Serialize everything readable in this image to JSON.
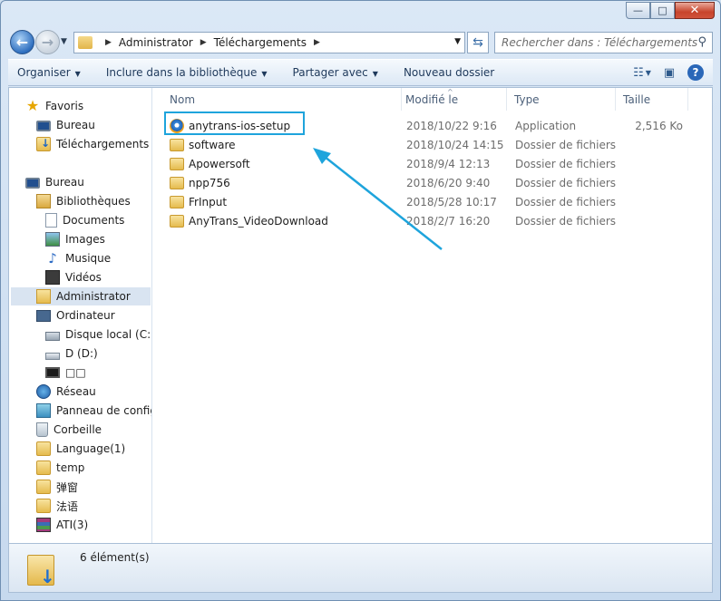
{
  "window": {
    "minimize_glyph": "—",
    "maximize_glyph": "□",
    "close_glyph": "✕"
  },
  "address": {
    "crumbs": [
      "Administrator",
      "Téléchargements"
    ],
    "search_placeholder": "Rechercher dans : Téléchargements"
  },
  "toolbar": {
    "organize": "Organiser",
    "include": "Inclure dans la bibliothèque",
    "share": "Partager avec",
    "new_folder": "Nouveau dossier"
  },
  "sidebar": {
    "items": [
      {
        "label": "Favoris",
        "icon": "star-icon"
      },
      {
        "label": "Bureau",
        "icon": "desktop-icon"
      },
      {
        "label": "Téléchargements",
        "icon": "downloads-folder-icon"
      },
      {
        "label": "Bureau",
        "icon": "desktop-icon"
      },
      {
        "label": "Bibliothèques",
        "icon": "libraries-icon"
      },
      {
        "label": "Documents",
        "icon": "document-icon"
      },
      {
        "label": "Images",
        "icon": "image-icon"
      },
      {
        "label": "Musique",
        "icon": "music-icon"
      },
      {
        "label": "Vidéos",
        "icon": "video-icon"
      },
      {
        "label": "Administrator",
        "icon": "user-folder-icon"
      },
      {
        "label": "Ordinateur",
        "icon": "computer-icon"
      },
      {
        "label": "Disque local (C:)",
        "icon": "local-disk-icon"
      },
      {
        "label": "D (D:)",
        "icon": "drive-icon"
      },
      {
        "label": "□□",
        "icon": "media-drive-icon"
      },
      {
        "label": "Réseau",
        "icon": "network-icon"
      },
      {
        "label": "Panneau de configu",
        "icon": "control-panel-icon"
      },
      {
        "label": "Corbeille",
        "icon": "recycle-bin-icon"
      },
      {
        "label": "Language(1)",
        "icon": "folder-icon"
      },
      {
        "label": "temp",
        "icon": "folder-icon"
      },
      {
        "label": "弹窗",
        "icon": "folder-icon"
      },
      {
        "label": "法语",
        "icon": "folder-icon"
      },
      {
        "label": "ATI(3)",
        "icon": "archive-icon"
      }
    ]
  },
  "columns": {
    "name": "Nom",
    "modified": "Modifié le",
    "type": "Type",
    "size": "Taille"
  },
  "files": [
    {
      "name": "anytrans-ios-setup",
      "modified": "2018/10/22 9:16",
      "type": "Application",
      "size": "2,516 Ko",
      "icon": "application-icon"
    },
    {
      "name": "software",
      "modified": "2018/10/24 14:15",
      "type": "Dossier de fichiers",
      "size": "",
      "icon": "folder-icon"
    },
    {
      "name": "Apowersoft",
      "modified": "2018/9/4 12:13",
      "type": "Dossier de fichiers",
      "size": "",
      "icon": "folder-icon"
    },
    {
      "name": "npp756",
      "modified": "2018/6/20 9:40",
      "type": "Dossier de fichiers",
      "size": "",
      "icon": "folder-icon"
    },
    {
      "name": "FrInput",
      "modified": "2018/5/28 10:17",
      "type": "Dossier de fichiers",
      "size": "",
      "icon": "folder-icon"
    },
    {
      "name": "AnyTrans_VideoDownload",
      "modified": "2018/2/7 16:20",
      "type": "Dossier de fichiers",
      "size": "",
      "icon": "folder-icon"
    }
  ],
  "status": {
    "count": "6 élément(s)"
  },
  "colors": {
    "highlight": "#1ea4dc",
    "selection": "#d9e4f1"
  }
}
